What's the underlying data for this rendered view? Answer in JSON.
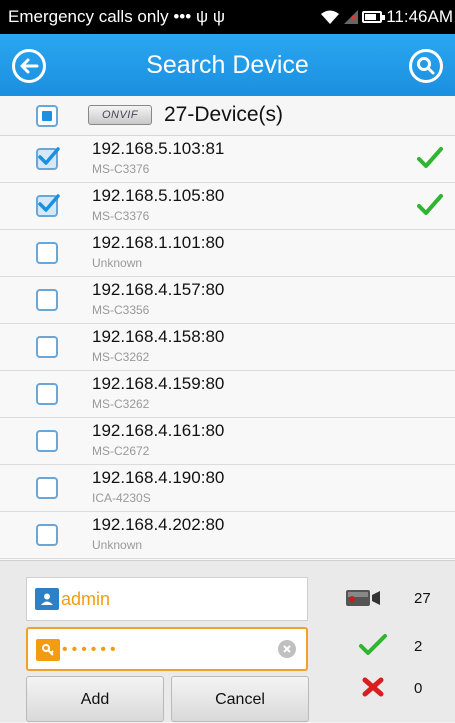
{
  "status_bar": {
    "carrier": "Emergency calls only",
    "time": "11:46AM"
  },
  "title_bar": {
    "title": "Search Device"
  },
  "header": {
    "protocol_badge": "ONVIF",
    "device_count": "27-Device(s)"
  },
  "devices": [
    {
      "ip": "192.168.5.103:81",
      "model": "MS-C3376",
      "checked": true,
      "added": true
    },
    {
      "ip": "192.168.5.105:80",
      "model": "MS-C3376",
      "checked": true,
      "added": true
    },
    {
      "ip": "192.168.1.101:80",
      "model": "Unknown",
      "checked": false,
      "added": false
    },
    {
      "ip": "192.168.4.157:80",
      "model": "MS-C3356",
      "checked": false,
      "added": false
    },
    {
      "ip": "192.168.4.158:80",
      "model": "MS-C3262",
      "checked": false,
      "added": false
    },
    {
      "ip": "192.168.4.159:80",
      "model": "MS-C3262",
      "checked": false,
      "added": false
    },
    {
      "ip": "192.168.4.161:80",
      "model": "MS-C2672",
      "checked": false,
      "added": false
    },
    {
      "ip": "192.168.4.190:80",
      "model": "ICA-4230S",
      "checked": false,
      "added": false
    },
    {
      "ip": "192.168.4.202:80",
      "model": "Unknown",
      "checked": false,
      "added": false
    }
  ],
  "form": {
    "username": "admin",
    "password_masked": "••••••"
  },
  "buttons": {
    "add": "Add",
    "cancel": "Cancel"
  },
  "stats": {
    "total": "27",
    "success": "2",
    "failed": "0"
  },
  "colors": {
    "accent": "#1b8fe0",
    "success": "#2fb52f",
    "error": "#d81e1e",
    "highlight": "#f39c12"
  }
}
